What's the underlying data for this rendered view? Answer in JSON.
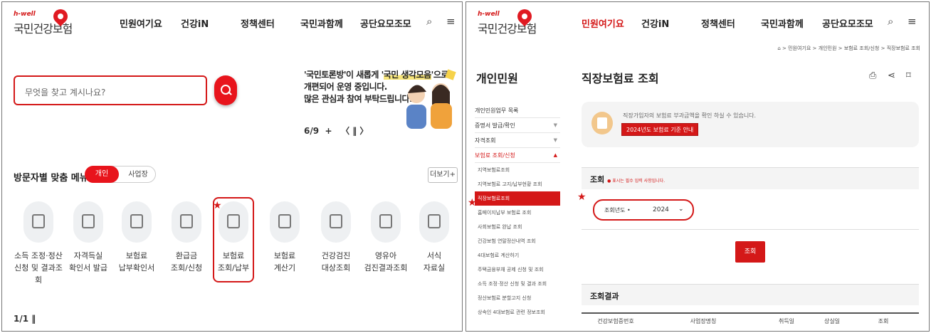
{
  "left": {
    "logo": {
      "tagline": "h-well",
      "name": "국민건강보험"
    },
    "nav": [
      "민원여기요",
      "건강iN",
      "정책센터",
      "국민과함께",
      "공단요모조모"
    ],
    "search": {
      "placeholder": "무엇을 찾고 계시나요?"
    },
    "banner": {
      "line1_a": "'국민토론방'이 새롭게 '",
      "line1_hl": "국민 생각모음",
      "line1_b": "'으로",
      "line2": "개편되어 운영 중입니다.",
      "line3": "많은 관심과 참여 부탁드립니다."
    },
    "carousel": {
      "page": "6/9",
      "plus": "+",
      "controls": "〈 ‖ 〉"
    },
    "menu_section": {
      "title": "방문자별 맞춤 메뉴",
      "tab_personal": "개인",
      "tab_business": "사업장",
      "more": "더보기+"
    },
    "menu_items": [
      {
        "line1": "소득 조정·정산",
        "line2": "신청 및 결과조회"
      },
      {
        "line1": "자격득실",
        "line2": "확인서 발급"
      },
      {
        "line1": "보험료",
        "line2": "납부확인서"
      },
      {
        "line1": "환급금",
        "line2": "조회/신청"
      },
      {
        "line1": "보험료",
        "line2": "조회/납부"
      },
      {
        "line1": "보험료",
        "line2": "계산기"
      },
      {
        "line1": "건강검진",
        "line2": "대상조회"
      },
      {
        "line1": "영유아",
        "line2": "검진결과조회"
      },
      {
        "line1": "서식",
        "line2": "자료실"
      }
    ],
    "bottom_pager": "1/1 ‖",
    "accent": "#d41818"
  },
  "right": {
    "logo": {
      "tagline": "h-well",
      "name": "국민건강보험"
    },
    "nav": [
      "민원여기요",
      "건강iN",
      "정책센터",
      "국민과함께",
      "공단요모조모"
    ],
    "breadcrumb": "⌂ > 민원여기요 > 개인민원 > 보험료 조회/신청 > 직장보험료 조회",
    "sidebar": {
      "title": "개인민원",
      "items": [
        "개인민원업무 목록",
        "증명서 발급/확인",
        "자격조회",
        "보험료 조회/신청"
      ],
      "subitems": [
        "지역보험료조회",
        "지역보험료 고지/납부현황 조회",
        "직장보험료조회",
        "홈페이지납부 보험료 조회",
        "사회보험료 완납 조회",
        "건강보험 연말정산내역 조회",
        "4대보험료 계산하기",
        "주택금융부채 공제 신청 및 조회",
        "소득 조정·정산 신청 및 결과 조회",
        "정산보험료 분할고지 신청",
        "상속인 4대보험료 관련 정보조회"
      ]
    },
    "page_title": "직장보험료 조회",
    "info": {
      "text": "직장가입자의 보험료 부과금액을 확인 하실 수 있습니다.",
      "button": "2024년도 보험료 기준 안내"
    },
    "form": {
      "title": "조회",
      "note": "● 표시는 필수 입력 사항입니다.",
      "year_label": "조회년도 •",
      "year_value": "2024"
    },
    "submit": "조회",
    "result_title": "조회결과",
    "table_headers": [
      "건강보험증번호",
      "사업장명칭",
      "취득일",
      "상실일",
      "조회"
    ]
  }
}
